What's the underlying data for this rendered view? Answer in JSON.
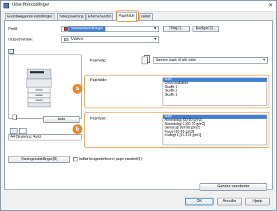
{
  "window": {
    "title": "Udskriftsindstillinger",
    "close_glyph": "✕"
  },
  "tabs": [
    {
      "label": "Grundlæggende indstillinger"
    },
    {
      "label": "Sideopsætning"
    },
    {
      "label": "Efterbehandlin"
    },
    {
      "label": "Papirkilde"
    },
    {
      "label": "valitet"
    }
  ],
  "profile": {
    "label": "Profil:",
    "value": "Standardindstillinger",
    "add_button": "Tilføj(1)...",
    "edit_button": "Rediger(2)..."
  },
  "output_method": {
    "label": "Outputmetode:",
    "value": "Udskriv"
  },
  "preview": {
    "auto_label": "Auto",
    "status": "A4 [Skalering: Auto]"
  },
  "paper_select": {
    "label": "Papirvalg:",
    "value": "Samme papir til alle sider"
  },
  "paper_source": {
    "label": "Papirkilde:",
    "badge": "a",
    "items": [
      "Auto",
      "Universalbakke",
      "Skuffe 1",
      "Skuffe 2",
      "Skuffe 3"
    ],
    "selected": "Auto"
  },
  "paper_type": {
    "label": "Papirtype:",
    "badge": "b",
    "items": [
      "Auto",
      "Almindeligt [60-90 g/m2]",
      "Almindeligt L [60-70 g/m2]",
      "Genbrugt [60-90 g/m2]",
      "Farve [60-90 g/m2]",
      "Kraftigt 1 [91-105 g/m2]"
    ],
    "selected": "Auto"
  },
  "view_settings_button": "Visningsindstillinger(9)",
  "custom_paper_checkbox": {
    "label": "Indfør brugerdefineret papir vandret(5)",
    "checked": false
  },
  "restore_defaults_button": "Gendan standarder",
  "footer": {
    "ok": "OK",
    "cancel": "Annuller",
    "help": "Hjælp"
  }
}
